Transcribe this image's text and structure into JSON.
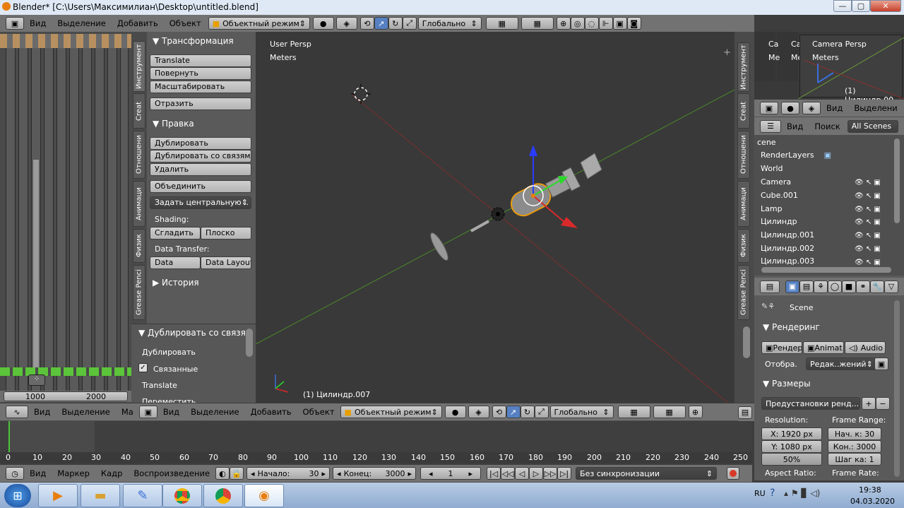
{
  "window": {
    "title": "Blender* [C:\\Users\\Максимилиан\\Desktop\\untitled.blend]",
    "min": "—",
    "max": "▢",
    "close": "✕"
  },
  "top_header": {
    "menus": [
      "Вид",
      "Выделение",
      "Добавить",
      "Объект"
    ],
    "mode": "Объектный режим",
    "orientation": "Глобально"
  },
  "right_header1": {
    "menus": [
      "Вид",
      "Выделени"
    ]
  },
  "outliner_header": {
    "view": "Вид",
    "search": "Поиск",
    "scenes": "All Scenes"
  },
  "outliner": [
    {
      "label": "cene"
    },
    {
      "label": "RenderLayers"
    },
    {
      "label": "World"
    },
    {
      "label": "Camera"
    },
    {
      "label": "Cube.001"
    },
    {
      "label": "Lamp"
    },
    {
      "label": "Цилиндр"
    },
    {
      "label": "Цилиндр.001"
    },
    {
      "label": "Цилиндр.002"
    },
    {
      "label": "Цилиндр.003"
    }
  ],
  "tool_tabs": [
    "Инструмент",
    "Creat",
    "Отношени",
    "Анимаци",
    "Физик",
    "Grease Penci"
  ],
  "tools": {
    "transform_title": "Трансформация",
    "transform": [
      "Translate",
      "Повернуть",
      "Масштабировать"
    ],
    "mirror": "Отразить",
    "edit_title": "Правка",
    "edit": [
      "Дублировать",
      "Дублировать со связям..",
      "Удалить"
    ],
    "join": "Объединить",
    "set_origin": "Задать центральную ..",
    "shading_label": "Shading:",
    "smooth": "Сгладить",
    "flat": "Плоско",
    "transfer_label": "Data Transfer:",
    "data": "Data",
    "data_layout": "Data Layout",
    "history_title": "История"
  },
  "operator": {
    "title": "Дублировать со связя",
    "rows": [
      "Дублировать",
      "Связанные",
      "Translate",
      "Переместить"
    ]
  },
  "viewport": {
    "persp": "User Persp",
    "units": "Meters",
    "object": "(1) Цилиндр.007"
  },
  "camera_view": {
    "persp": "Camera Persp",
    "units": "Meters",
    "object": "(1) Цилиндр.00",
    "left1": "Ca",
    "left2": "Me",
    "left3": "Ca",
    "left4": "Me"
  },
  "strips": {
    "from": "1000",
    "to": "2000"
  },
  "bottom_header": {
    "menus": [
      "Вид",
      "Выделение",
      "Ma",
      "Вид",
      "Выделение",
      "Добавить",
      "Объект"
    ],
    "mode": "Объектный режим",
    "orientation": "Глобально"
  },
  "timeline": {
    "ticks": [
      "0",
      "10",
      "20",
      "30",
      "40",
      "50",
      "60",
      "70",
      "80",
      "90",
      "100",
      "110",
      "120",
      "130",
      "140",
      "150",
      "160",
      "170",
      "180",
      "190",
      "200",
      "210",
      "220",
      "230",
      "240",
      "250"
    ],
    "menus": [
      "Вид",
      "Маркер",
      "Кадр",
      "Воспроизведение"
    ],
    "start_label": "Начало:",
    "start": "30",
    "end_label": "Конец:",
    "end": "3000",
    "current": "1",
    "sync": "Без синхронизации"
  },
  "properties": {
    "scene": "Scene",
    "render_title": "Рендеринг",
    "render_btn": "Рендер",
    "anim_btn": "Animat.",
    "audio_btn": "Audio",
    "display_label": "Отобра.",
    "display_value": "Редак..жений",
    "dims_title": "Размеры",
    "preset": "Предустановки ренд...",
    "resolution": "Resolution:",
    "resx": "X: 1920 px",
    "resy": "Y: 1080 px",
    "percent": "50%",
    "frame_range": "Frame Range:",
    "start": "Нач. к: 30",
    "end": "Кон.: 3000",
    "step": "Шаг ка: 1",
    "aspect": "Aspect Ratio:",
    "framerate": "Frame Rate:"
  },
  "taskbar": {
    "lang": "RU",
    "time": "19:38",
    "date": "04.03.2020"
  }
}
